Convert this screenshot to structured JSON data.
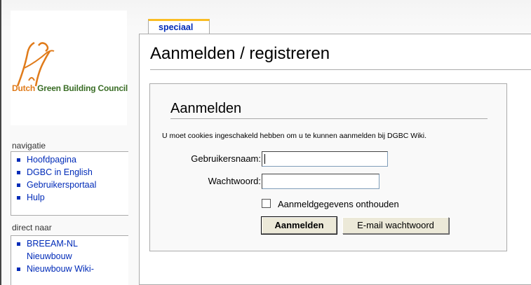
{
  "logo": {
    "text_dutch": "Dutch",
    "text_rest": " Green Building Council"
  },
  "navigatie": {
    "title": "navigatie",
    "items": [
      {
        "label": "Hoofdpagina"
      },
      {
        "label": "DGBC in English"
      },
      {
        "label": "Gebruikersportaal"
      },
      {
        "label": "Hulp"
      }
    ]
  },
  "direct": {
    "title": "direct naar",
    "items": [
      {
        "label": "BREEAM-NL"
      },
      {
        "label": "Nieuwbouw"
      },
      {
        "label": "Nieuwbouw Wiki-"
      }
    ]
  },
  "tab": {
    "label": "speciaal"
  },
  "page": {
    "title": "Aanmelden / registreren"
  },
  "login": {
    "title": "Aanmelden",
    "notice": "U moet cookies ingeschakeld hebben om u te kunnen aanmelden bij DGBC Wiki.",
    "username_label": "Gebruikersnaam:",
    "username_value": "",
    "password_label": "Wachtwoord:",
    "password_value": "",
    "remember_label": "Aanmeldgegevens onthouden",
    "remember_checked": false,
    "submit_label": "Aanmelden",
    "email_label": "E-mail wachtwoord"
  },
  "colors": {
    "link": "#002bb8",
    "tab_accent": "#fabd23",
    "logo_green": "#3a6d26",
    "logo_orange": "#e07b1a"
  }
}
